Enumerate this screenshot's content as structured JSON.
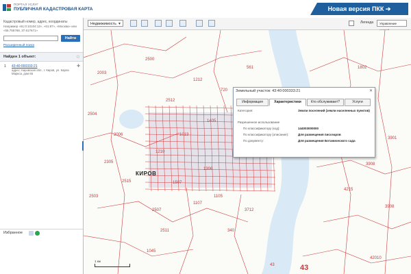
{
  "header": {
    "portal_name": "ПОРТАЛ УСЛУГ",
    "portal_title": "ПУБЛИЧНАЯ КАДАСТРОВАЯ КАРТА",
    "new_version": "Новая версия ПКК ➔"
  },
  "sidebar": {
    "search_label": "Кадастровый номер, адрес, координаты",
    "search_example": "Например «61:0:10104:12», «61:87», «Москва» или «55.755768, 37.617671»",
    "search_value": "",
    "find_button": "Найти",
    "advanced_link": "Расширенный поиск",
    "results_count": "Найден 1 объект:",
    "result": {
      "num": "1",
      "id": "43:40:000333:21",
      "address": "адрес: Кировская обл., г. Киров, ул. Карла Маркса, дом 65"
    },
    "favorites_label": "Избранное"
  },
  "toolbar": {
    "category": "Недвижимость",
    "legend": "Легенда",
    "map_control": "Управление картой"
  },
  "map": {
    "city": "КИРОВ",
    "labels": [
      "2504",
      "2503",
      "2006",
      "2515",
      "1045",
      "43",
      "561",
      "1802",
      "3908",
      "3908",
      "4215",
      "42010",
      "3901",
      "2507",
      "1212",
      "2512",
      "720",
      "1013",
      "2511",
      "1306",
      "1507",
      "1105",
      "3712",
      "1107",
      "2500",
      "2003",
      "340",
      "2305",
      "1405",
      "1210"
    ],
    "big_number": "43",
    "scale": "1 км"
  },
  "popup": {
    "title": "Земельный участок: 43:40:000333:21",
    "tabs": [
      "Информация",
      "Характеристики",
      "Кто обслуживает?",
      "Услуги"
    ],
    "category_label": "Категория:",
    "category_value": "Земли поселений (земли населенных пунктов)",
    "permitted_label": "Разрешенное использование",
    "code_label": "По классификатору (код):",
    "code_value": "144003000000",
    "desc_label": "По классификатору (описание):",
    "desc_value": "Для размещения писсеаров",
    "doc_label": "По документу:",
    "doc_value": "Для размещения Ботанического сада"
  },
  "colors": {
    "brand": "#1f5f9e",
    "parcel_lines": "#cf3a3a",
    "highlight": "#d8dcef"
  }
}
